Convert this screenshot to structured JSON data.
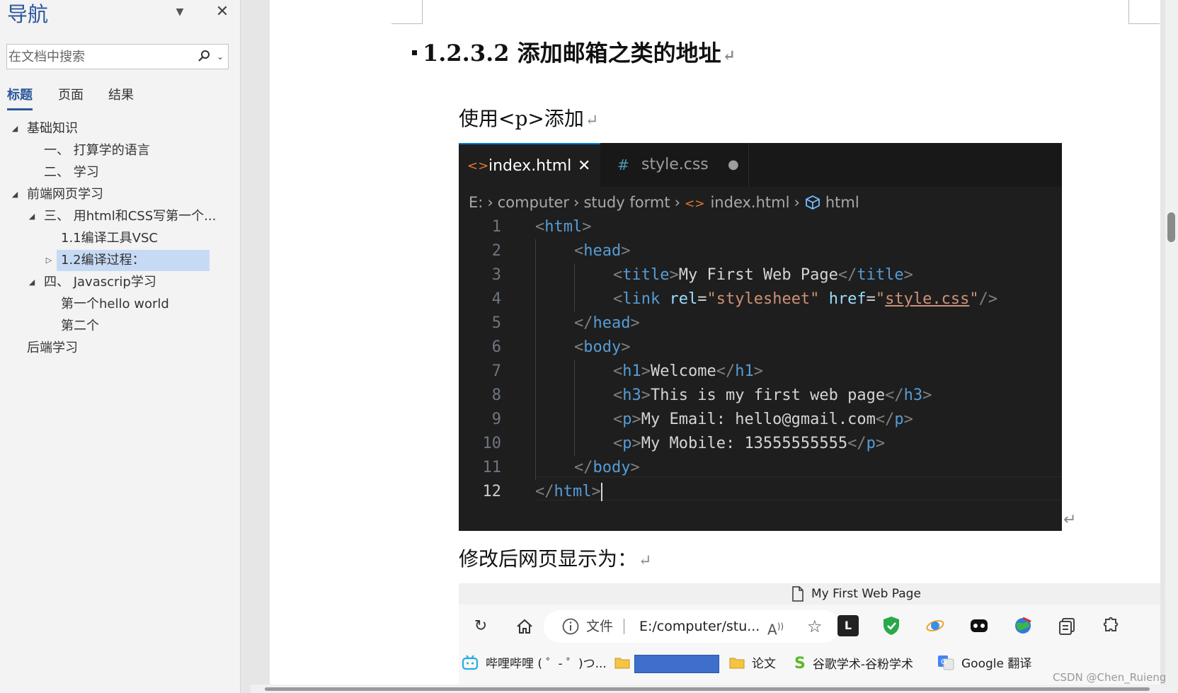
{
  "nav": {
    "title": "导航",
    "search_placeholder": "在文档中搜索",
    "tabs": [
      "标题",
      "页面",
      "结果"
    ],
    "tree": [
      {
        "label": "基础知识",
        "level": 0,
        "toggle": "expanded"
      },
      {
        "label": "一、 打算学的语言",
        "level": 1,
        "toggle": "none"
      },
      {
        "label": "二、 学习",
        "level": 1,
        "toggle": "none"
      },
      {
        "label": "前端网页学习",
        "level": 0,
        "toggle": "expanded"
      },
      {
        "label": "三、 用html和CSS写第一个...",
        "level": 1,
        "toggle": "expanded"
      },
      {
        "label": "1.1编译工具VSC",
        "level": 2,
        "toggle": "none"
      },
      {
        "label": "1.2编译过程：",
        "level": 2,
        "toggle": "collapsed",
        "selected": true
      },
      {
        "label": "四、 Javascrip学习",
        "level": 1,
        "toggle": "expanded"
      },
      {
        "label": "第一个hello world",
        "level": 2,
        "toggle": "none"
      },
      {
        "label": "第二个",
        "level": 2,
        "toggle": "none"
      },
      {
        "label": "后端学习",
        "level": 0,
        "toggle": "none"
      }
    ]
  },
  "doc": {
    "heading": "1.2.3.2 添加邮箱之类的地址",
    "para1": "使用<p>添加",
    "para2": "修改后网页显示为：",
    "para_mark": "↵"
  },
  "vscode": {
    "tabs": [
      {
        "icon": "<>",
        "label": "index.html",
        "close": "✕"
      },
      {
        "icon": "#",
        "label": "style.css",
        "close": "●"
      }
    ],
    "breadcrumb": [
      "E:",
      "computer",
      "study formt",
      "index.html",
      "html"
    ],
    "lines": [
      {
        "n": "1",
        "indent": 0,
        "tokens": [
          [
            "p",
            "<"
          ],
          [
            "tag",
            "html"
          ],
          [
            "p",
            ">"
          ]
        ]
      },
      {
        "n": "2",
        "indent": 1,
        "tokens": [
          [
            "p",
            "<"
          ],
          [
            "tag",
            "head"
          ],
          [
            "p",
            ">"
          ]
        ]
      },
      {
        "n": "3",
        "indent": 2,
        "tokens": [
          [
            "p",
            "<"
          ],
          [
            "tag",
            "title"
          ],
          [
            "p",
            ">"
          ],
          [
            "txt",
            "My First Web Page"
          ],
          [
            "p",
            "</"
          ],
          [
            "tag",
            "title"
          ],
          [
            "p",
            ">"
          ]
        ]
      },
      {
        "n": "4",
        "indent": 2,
        "tokens": [
          [
            "p",
            "<"
          ],
          [
            "tag",
            "link"
          ],
          [
            "txt",
            " "
          ],
          [
            "attr",
            "rel"
          ],
          [
            "txt",
            "="
          ],
          [
            "str",
            "\"stylesheet\""
          ],
          [
            "txt",
            " "
          ],
          [
            "attr",
            "href"
          ],
          [
            "txt",
            "="
          ],
          [
            "str",
            "\""
          ],
          [
            "strul",
            "style.css"
          ],
          [
            "str",
            "\""
          ],
          [
            "p",
            "/>"
          ]
        ]
      },
      {
        "n": "5",
        "indent": 1,
        "tokens": [
          [
            "p",
            "</"
          ],
          [
            "tag",
            "head"
          ],
          [
            "p",
            ">"
          ]
        ]
      },
      {
        "n": "6",
        "indent": 1,
        "tokens": [
          [
            "p",
            "<"
          ],
          [
            "tag",
            "body"
          ],
          [
            "p",
            ">"
          ]
        ]
      },
      {
        "n": "7",
        "indent": 2,
        "tokens": [
          [
            "p",
            "<"
          ],
          [
            "tag",
            "h1"
          ],
          [
            "p",
            ">"
          ],
          [
            "txt",
            "Welcome"
          ],
          [
            "p",
            "</"
          ],
          [
            "tag",
            "h1"
          ],
          [
            "p",
            ">"
          ]
        ]
      },
      {
        "n": "8",
        "indent": 2,
        "tokens": [
          [
            "p",
            "<"
          ],
          [
            "tag",
            "h3"
          ],
          [
            "p",
            ">"
          ],
          [
            "txt",
            "This is my first web page"
          ],
          [
            "p",
            "</"
          ],
          [
            "tag",
            "h3"
          ],
          [
            "p",
            ">"
          ]
        ]
      },
      {
        "n": "9",
        "indent": 2,
        "tokens": [
          [
            "p",
            "<"
          ],
          [
            "tag",
            "p"
          ],
          [
            "p",
            ">"
          ],
          [
            "txt",
            "My Email: hello@gmail.com"
          ],
          [
            "p",
            "</"
          ],
          [
            "tag",
            "p"
          ],
          [
            "p",
            ">"
          ]
        ]
      },
      {
        "n": "10",
        "indent": 2,
        "tokens": [
          [
            "p",
            "<"
          ],
          [
            "tag",
            "p"
          ],
          [
            "p",
            ">"
          ],
          [
            "txt",
            "My Mobile: 13555555555"
          ],
          [
            "p",
            "</"
          ],
          [
            "tag",
            "p"
          ],
          [
            "p",
            ">"
          ]
        ]
      },
      {
        "n": "11",
        "indent": 1,
        "tokens": [
          [
            "p",
            "</"
          ],
          [
            "tag",
            "body"
          ],
          [
            "p",
            ">"
          ]
        ]
      },
      {
        "n": "12",
        "indent": 0,
        "tokens": [
          [
            "p",
            "</"
          ],
          [
            "tag",
            "html"
          ],
          [
            "p",
            ">"
          ]
        ],
        "current": true
      }
    ]
  },
  "browser": {
    "title": "My First Web Page",
    "address_label": "文件",
    "url": "E:/computer/stu...",
    "favorites": [
      {
        "label": "哔哩哔哩 ( ゜- ゜)つ..."
      },
      {
        "label": ""
      },
      {
        "label": "论文"
      },
      {
        "label": "谷歌学术-谷粉学术"
      },
      {
        "label": "Google 翻译"
      }
    ]
  },
  "watermark": "CSDN @Chen_Ruieng",
  "colors": {
    "accent": "#2b579a",
    "selection": "#c7daf5",
    "vscode_bg": "#1e1e1e",
    "tag": "#569cd6",
    "attr": "#9cdcfe",
    "string": "#ce9178"
  }
}
